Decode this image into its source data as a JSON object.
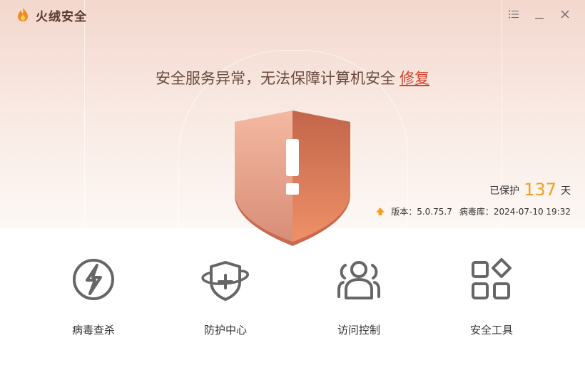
{
  "app": {
    "name": "火绒安全",
    "brand_color": "#f0a020"
  },
  "window_controls": {
    "menu_icon": "menu-icon",
    "minimize_icon": "minimize-icon",
    "close_icon": "close-icon"
  },
  "status": {
    "message": "安全服务异常，无法保障计算机安全",
    "fix_link": "修复",
    "alert_color": "#d9432c"
  },
  "protection": {
    "prefix": "已保护",
    "days": "137",
    "suffix": "天",
    "version_label": "版本：5.0.75.7",
    "virus_db_label": "病毒库：2024-07-10 19:32"
  },
  "tools": [
    {
      "label": "病毒查杀",
      "icon": "virus-scan-icon"
    },
    {
      "label": "防护中心",
      "icon": "protection-center-icon"
    },
    {
      "label": "访问控制",
      "icon": "access-control-icon"
    },
    {
      "label": "安全工具",
      "icon": "security-tools-icon"
    }
  ]
}
